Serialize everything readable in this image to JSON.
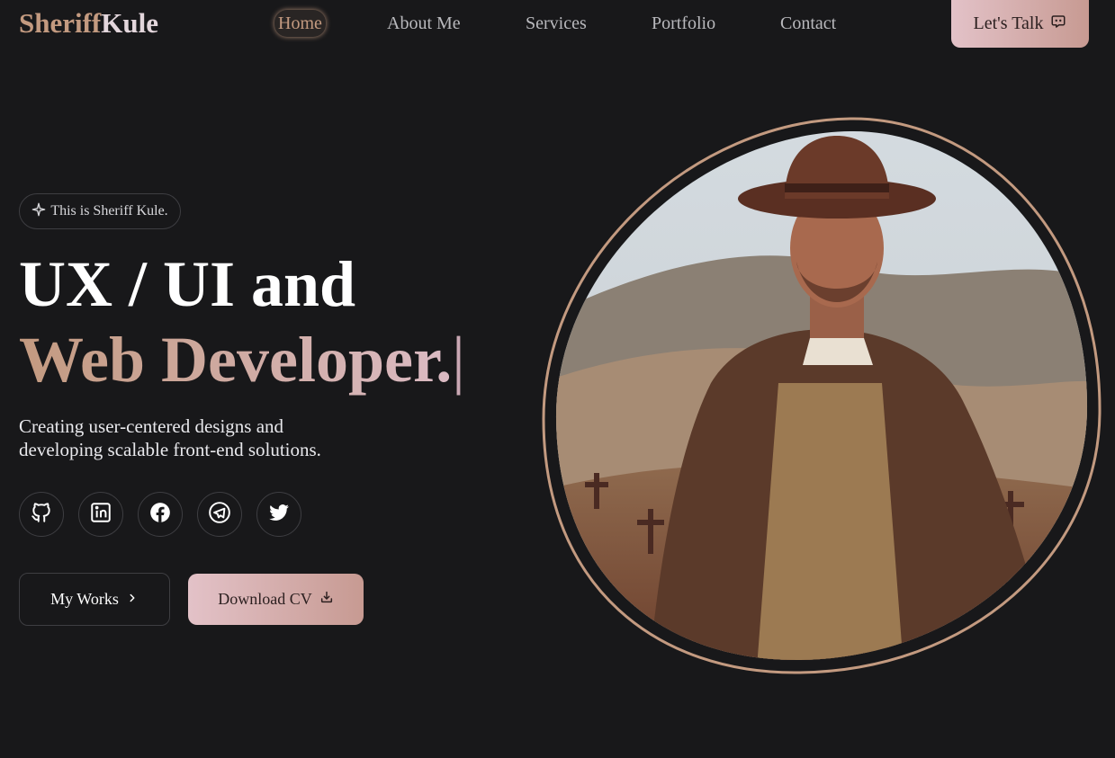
{
  "header": {
    "logo_first": "Sheriff",
    "logo_second": "Kule",
    "nav": [
      {
        "label": "Home",
        "active": true
      },
      {
        "label": "About Me",
        "active": false
      },
      {
        "label": "Services",
        "active": false
      },
      {
        "label": "Portfolio",
        "active": false
      },
      {
        "label": "Contact",
        "active": false
      }
    ],
    "cta_label": "Let's Talk",
    "cta_icon": "chat-bubble-icon"
  },
  "hero": {
    "tag": "This is Sheriff Kule.",
    "tag_icon": "sparkle-icon",
    "title_line1": "UX / UI and",
    "title_line2": "Web Developer.",
    "typing_cursor": "|",
    "description": "Creating user-centered designs and developing scalable front-end solutions.",
    "socials": [
      "github-icon",
      "linkedin-icon",
      "facebook-icon",
      "telegram-icon",
      "twitter-icon"
    ],
    "primary_button": "My Works",
    "primary_button_icon": "chevron-right-icon",
    "secondary_button": "Download CV",
    "secondary_button_icon": "download-icon"
  },
  "portrait": {
    "description_icon": "portrait-photo"
  },
  "colors": {
    "background": "#18181a",
    "accent": "#c39a80",
    "accent_light": "#dcbcc6",
    "button_gradient_start": "#e3c2c8",
    "button_gradient_end": "#c79a92"
  }
}
